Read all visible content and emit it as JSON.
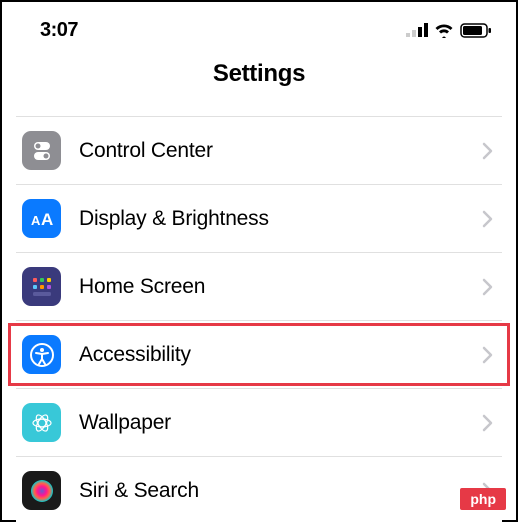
{
  "status": {
    "time": "3:07"
  },
  "header": {
    "title": "Settings"
  },
  "items": [
    {
      "label": "Control Center",
      "icon": "control-center-icon",
      "highlighted": false
    },
    {
      "label": "Display & Brightness",
      "icon": "display-icon",
      "highlighted": false
    },
    {
      "label": "Home Screen",
      "icon": "home-screen-icon",
      "highlighted": false
    },
    {
      "label": "Accessibility",
      "icon": "accessibility-icon",
      "highlighted": true
    },
    {
      "label": "Wallpaper",
      "icon": "wallpaper-icon",
      "highlighted": false
    },
    {
      "label": "Siri & Search",
      "icon": "siri-icon",
      "highlighted": false
    }
  ],
  "watermark": "php"
}
